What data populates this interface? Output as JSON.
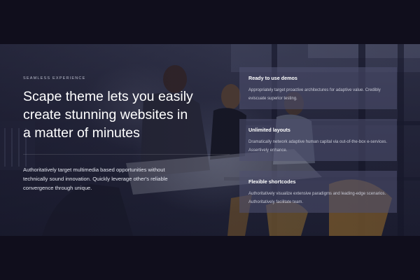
{
  "hero": {
    "eyebrow": "SEAMLESS EXPERIENCE",
    "headline": "Scape theme lets you easily create stunning websites in a matter of minutes",
    "body": "Authoritatively target multimedia based opportunities without technically sound innovation. Quickly leverage other's reliable convergence through unique."
  },
  "features": [
    {
      "title": "Ready to use demos",
      "text": "Appropriately target proactive architectures for adaptive value. Credibly eviscuate superior testing."
    },
    {
      "title": "Unlimited layouts",
      "text": "Dramatically network adaptive human capital via out-of-the-box e-services. Assertively enhance."
    },
    {
      "title": "Flexible shortcodes",
      "text": "Authoritatively visualize extensive paradigms and leading-edge scenarios. Authoritatively facilitate team."
    }
  ]
}
